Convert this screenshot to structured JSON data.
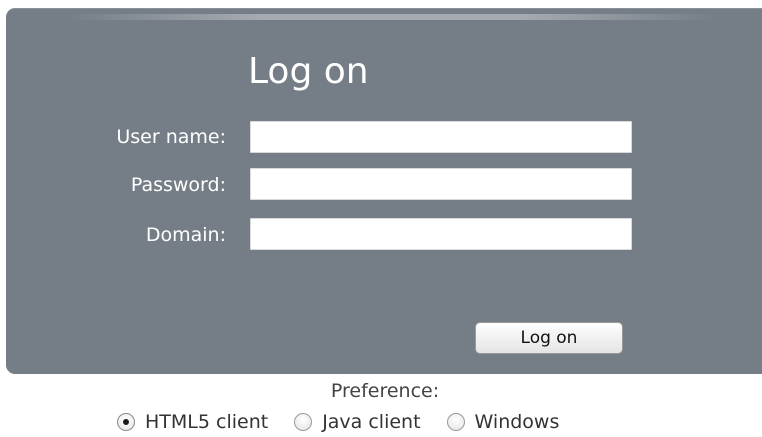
{
  "login": {
    "title": "Log on",
    "fields": [
      {
        "label": "User name:",
        "value": "",
        "placeholder": ""
      },
      {
        "label": "Password:",
        "value": "",
        "placeholder": ""
      },
      {
        "label": "Domain:",
        "value": "",
        "placeholder": ""
      }
    ],
    "submit_label": "Log on"
  },
  "preference": {
    "label": "Preference:",
    "options": [
      {
        "label": "HTML5 client",
        "selected": true
      },
      {
        "label": "Java client",
        "selected": false
      },
      {
        "label": "Windows",
        "selected": false
      }
    ]
  },
  "colors": {
    "panel": "#757e86",
    "text_on_panel": "#ffffff"
  }
}
